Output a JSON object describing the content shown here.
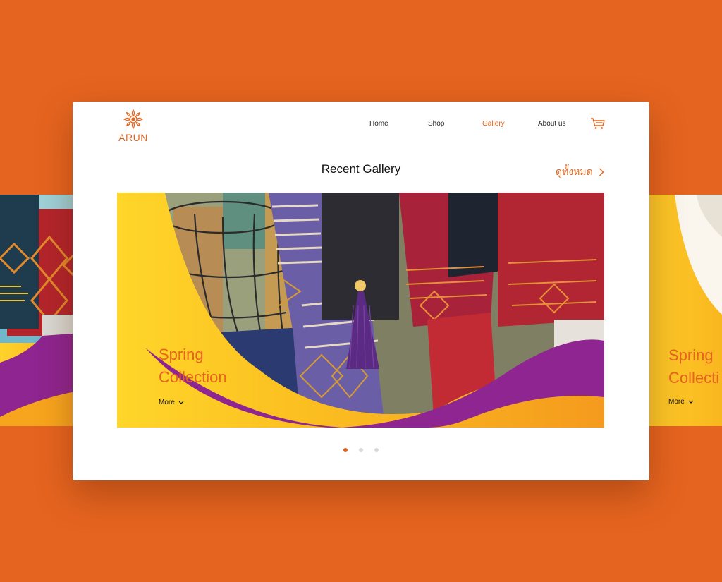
{
  "brand": {
    "name": "ARUN",
    "accent": "#E5641F",
    "purple": "#8E2590",
    "yellow": "#FFD22B"
  },
  "nav": {
    "items": [
      {
        "label": "Home",
        "active": false
      },
      {
        "label": "Shop",
        "active": false
      },
      {
        "label": "Gallery",
        "active": true
      },
      {
        "label": "About us",
        "active": false
      }
    ],
    "cart_icon": "cart-icon"
  },
  "gallery": {
    "title": "Recent Gallery",
    "see_all_label": "ดูทั้งหมด",
    "slides": [
      {
        "title_line1": "Spring",
        "title_line2": "Collection",
        "more_label": "More"
      }
    ],
    "right_preview": {
      "title_line1": "Spring",
      "title_line2": "Collecti",
      "more_label": "More"
    },
    "pagination": {
      "current": 1,
      "total": 3
    }
  }
}
